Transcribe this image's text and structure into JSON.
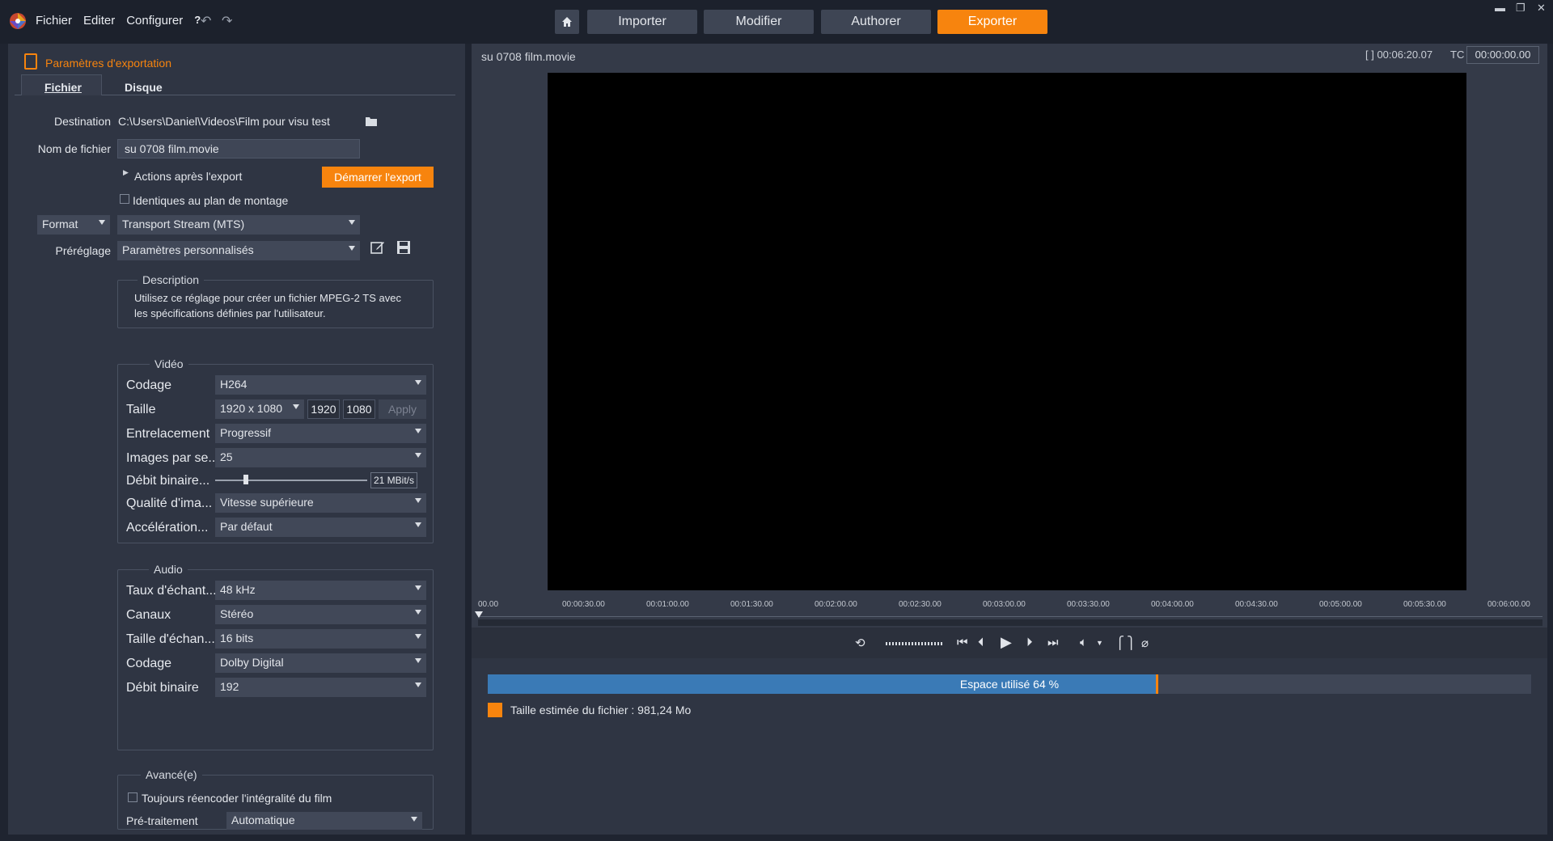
{
  "menu": {
    "file": "Fichier",
    "edit": "Editer",
    "configure": "Configurer",
    "help": "?"
  },
  "modes": {
    "import": "Importer",
    "edit": "Modifier",
    "author": "Authorer",
    "export": "Exporter"
  },
  "panel": {
    "title": "Paramètres d'exportation",
    "tabs": [
      "Fichier",
      "Disque"
    ],
    "destination_label": "Destination",
    "destination_value": "C:\\Users\\Daniel\\Videos\\Film pour visu test",
    "filename_label": "Nom de fichier",
    "filename_value": "su 0708 film.movie",
    "actions_label": "Actions après l'export",
    "start_export": "Démarrer l'export",
    "same_timeline": "Identiques au plan de montage",
    "format_label": "Format",
    "format_value": "Transport Stream (MTS)",
    "preset_label": "Préréglage",
    "preset_value": "Paramètres personnalisés",
    "description_title": "Description",
    "description_text_1": "Utilisez ce réglage pour créer un fichier MPEG-2 TS avec",
    "description_text_2": "les spécifications définies par l'utilisateur."
  },
  "video": {
    "title": "Vidéo",
    "codec_label": "Codage",
    "codec_value": "H264",
    "size_label": "Taille",
    "size_value": "1920 x 1080",
    "width": "1920",
    "height": "1080",
    "apply": "Apply",
    "interlace_label": "Entrelacement",
    "interlace_value": "Progressif",
    "fps_label": "Images par se...",
    "fps_value": "25",
    "bitrate_label": "Débit binaire...",
    "bitrate_value": "21 MBit/s",
    "bitrate_level": 0.2,
    "quality_label": "Qualité d'ima...",
    "quality_value": "Vitesse supérieure",
    "accel_label": "Accélération...",
    "accel_value": "Par défaut"
  },
  "audio": {
    "title": "Audio",
    "rate_label": "Taux d'échant...",
    "rate_value": "48 kHz",
    "channels_label": "Canaux",
    "channels_value": "Stéréo",
    "sample_label": "Taille d'échan...",
    "sample_value": "16 bits",
    "codec_label": "Codage",
    "codec_value": "Dolby Digital",
    "bitrate_label": "Débit binaire",
    "bitrate_value": "192"
  },
  "advanced": {
    "title": "Avancé(e)",
    "reencode": "Toujours réencoder l'intégralité du film",
    "preprocess_label": "Pré-traitement",
    "preprocess_value": "Automatique"
  },
  "preview": {
    "clip_name": "su 0708 film.movie",
    "duration": "[ ] 00:06:20.07",
    "tc_label": "TC",
    "tc_value": "00:00:00.00",
    "ruler": [
      "00.00",
      "00:00:30.00",
      "00:01:00.00",
      "00:01:30.00",
      "00:02:00.00",
      "00:02:30.00",
      "00:03:00.00",
      "00:03:30.00",
      "00:04:00.00",
      "00:04:30.00",
      "00:05:00.00",
      "00:05:30.00",
      "00:06:00.00"
    ]
  },
  "disk": {
    "used_text": "Espace utilisé 64 %",
    "used_fraction": 0.64,
    "estimate": "Taille estimée du fichier : 981,24 Mo"
  },
  "colors": {
    "accent": "#f7840e",
    "progress": "#3a7ab6"
  }
}
